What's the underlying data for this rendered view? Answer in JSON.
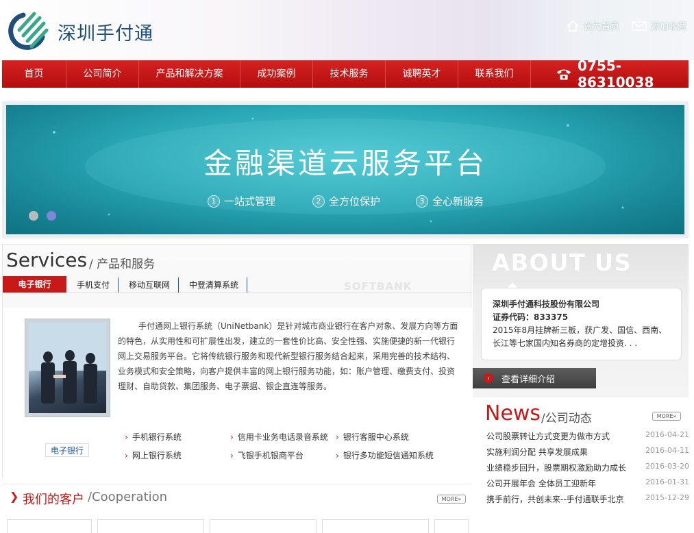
{
  "header": {
    "logo_text": "深圳手付通",
    "set_home": "设为首页",
    "add_favorite": "添加收藏"
  },
  "nav": {
    "items": [
      "首页",
      "公司简介",
      "产品和解决方案",
      "成功案例",
      "技术服务",
      "诚聘英才",
      "联系我们"
    ],
    "phone": "0755-86310038"
  },
  "banner": {
    "title": "金融渠道云服务平台",
    "features": [
      {
        "num": "1",
        "label": "一站式管理"
      },
      {
        "num": "2",
        "label": "全方位保护"
      },
      {
        "num": "3",
        "label": "全心新服务"
      }
    ]
  },
  "services": {
    "title": "Services",
    "subtitle": "/ 产品和服务",
    "tabs": [
      "电子银行",
      "手机支付",
      "移动互联网",
      "中登清算系统"
    ],
    "watermark": "SOFTBANK",
    "photo_label": "电子银行",
    "description": "手付通网上银行系统（UniNetbank）是针对城市商业银行在客户对象、发展方向等方面的特色，从实用性和可扩展性出发，建立的一套性价比高、安全性强、实施便捷的新一代银行网上交易服务平台。它将传统银行服务和现代新型银行服务结合起来，采用完善的技术结构、业务模式和安全策略，向客户提供丰富的网上银行服务功能，如：账户管理、缴费支付、投资理财、自助贷款、集团服务、电子票据、银企直连等服务。",
    "systems": [
      "手机银行系统",
      "信用卡业务电话录音系统",
      "银行客服中心系统",
      "网上银行系统",
      "飞银手机银商平台",
      "银行多功能短信通知系统"
    ]
  },
  "about": {
    "title": "ABOUT US",
    "company": "深圳手付通科技股份有限公司",
    "stock_code": "证券代码：833375",
    "summary": "2015年8月挂牌新三板，获广发、国信、西南、长江等七家国内知名券商的定增投资. . .",
    "button": "查看详细介绍"
  },
  "news": {
    "title": "News",
    "subtitle": "/公司动态",
    "more": "MORE»",
    "items": [
      {
        "title": "公司股票转让方式变更为做市方式",
        "date": "2016-04-21"
      },
      {
        "title": "实施利润分配 共享发展成果",
        "date": "2016-04-11"
      },
      {
        "title": "业绩稳步回升，股票期权激励助力成长",
        "date": "2016-03-20"
      },
      {
        "title": "公司开展年会 全体员工迎新年",
        "date": "2016-01-31"
      },
      {
        "title": "携手前行，共创未来--手付通联手北京",
        "date": "2015-12-29"
      }
    ]
  },
  "clients": {
    "title": "我们的客户",
    "subtitle": "/Cooperation",
    "more": "MORE»"
  },
  "colors": {
    "accent_red": "#c81818",
    "banner_teal": "#2aa8b6",
    "logo_blue": "#1e4e79",
    "logo_green": "#3aa88a"
  }
}
